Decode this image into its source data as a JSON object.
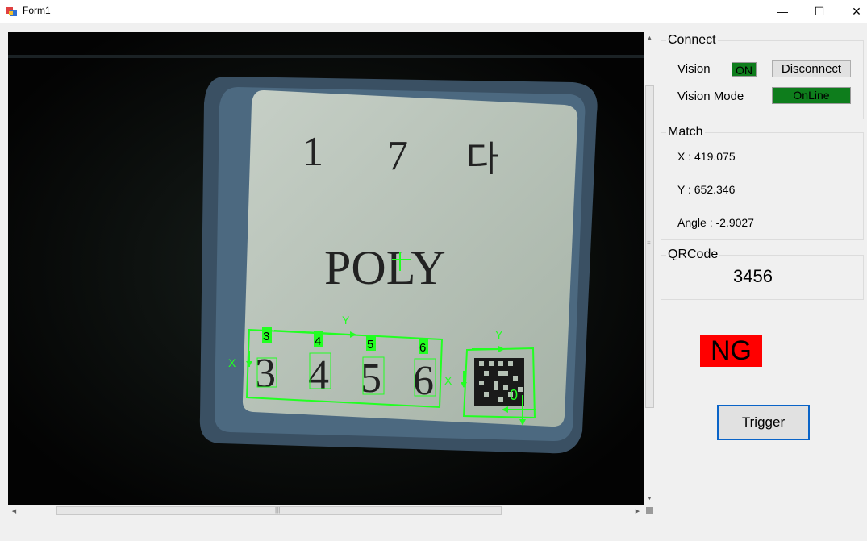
{
  "window": {
    "title": "Form1",
    "minimize_glyph": "—",
    "maximize_glyph": "☐",
    "close_glyph": "✕"
  },
  "viewer": {
    "label_text": "POLY",
    "header_chars": [
      "1",
      "7",
      "다"
    ],
    "digits": [
      "3",
      "4",
      "5",
      "6"
    ],
    "overlay_digits": [
      "3",
      "4",
      "5",
      "6"
    ],
    "axis_x": "X",
    "axis_y": "Y",
    "qr_origin_label": "0",
    "overlay_color": "#22ff22"
  },
  "connect": {
    "title": "Connect",
    "vision_label": "Vision",
    "vision_status": "ON",
    "disconnect_button": "Disconnect",
    "mode_label": "Vision Mode",
    "mode_status": "OnLine"
  },
  "match": {
    "title": "Match",
    "x": "X : 419.075",
    "y": "Y : 652.346",
    "angle": "Angle : -2.9027"
  },
  "qrcode": {
    "title": "QRCode",
    "value": "3456"
  },
  "result": {
    "text": "NG",
    "color": "#ff0000"
  },
  "trigger_button": "Trigger"
}
